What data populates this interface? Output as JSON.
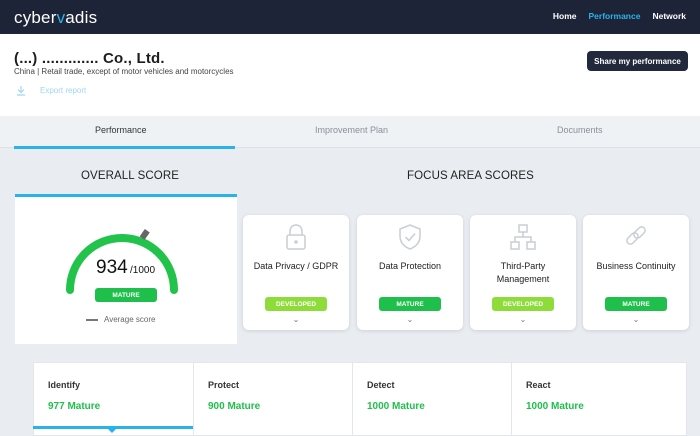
{
  "app": {
    "logo_pre": "cyber",
    "logo_v": "v",
    "logo_post": "adis"
  },
  "nav": {
    "items": [
      "Home",
      "Performance",
      "Network"
    ],
    "active": "Performance"
  },
  "company": {
    "name": "(...) ............. Co., Ltd.",
    "sector": "China | Retail trade, except of motor vehicles and motorcycles",
    "export_label": "Export report",
    "share_label": "Share my performance"
  },
  "tabs": [
    "Performance",
    "Improvement Plan",
    "Documents"
  ],
  "overall": {
    "title": "OVERALL SCORE",
    "score": "934",
    "out_of": "/1000",
    "level": "MATURE",
    "level_fraction": 0.934,
    "avg_label": "Average score"
  },
  "focus": {
    "title": "FOCUS AREA SCORES",
    "cards": [
      {
        "label": "Data Privacy / GDPR",
        "badge": "DEVELOPED",
        "icon": "lock-icon"
      },
      {
        "label": "Data Protection",
        "badge": "MATURE",
        "icon": "shield-icon"
      },
      {
        "label": "Third-Party Management",
        "badge": "DEVELOPED",
        "icon": "network-icon"
      },
      {
        "label": "Business Continuity",
        "badge": "MATURE",
        "icon": "chain-link-icon"
      }
    ]
  },
  "nist": [
    {
      "name": "Identify",
      "score": "977 Mature"
    },
    {
      "name": "Protect",
      "score": "900 Mature"
    },
    {
      "name": "Detect",
      "score": "1000 Mature"
    },
    {
      "name": "React",
      "score": "1000 Mature"
    }
  ],
  "colors": {
    "accent": "#2ab3ea",
    "mature": "#1fbf4c",
    "developed": "#8edc3a",
    "nav_bg": "#1d2438"
  }
}
